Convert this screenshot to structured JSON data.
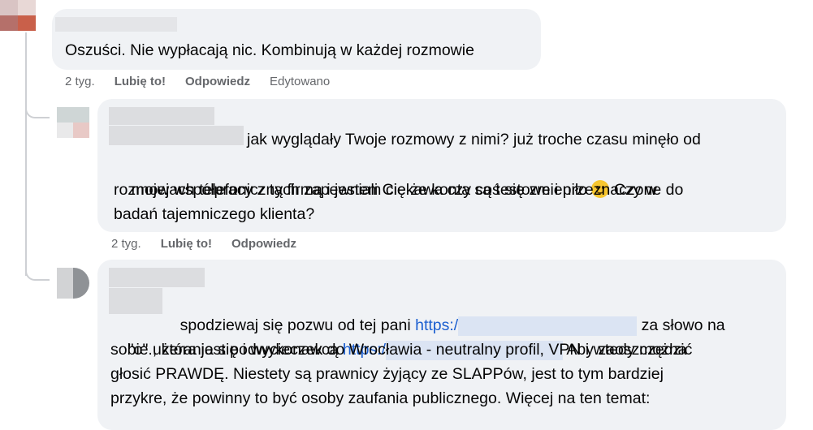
{
  "comments": [
    {
      "text": "Oszuści. Nie wypłacają nic. Kombinują w każdej rozmowie",
      "meta": {
        "time": "2 tyg.",
        "like": "Lubię to!",
        "reply": "Odpowiedz",
        "edited": "Edytowano"
      }
    },
    {
      "lines": [
        "jak wyglądały Twoje rozmowy z nimi? już troche czasu minęło od",
        "mojej współpracy z tą firmą i jestem ciekawa czy coś się zmieniło",
        "Czy w",
        "rozmowach telefonicznych zapewniali Cię że konta są testowe i przeznaczone do",
        "badań tajemniczego klienta?"
      ],
      "emoji": "smiling-face-emoji",
      "meta": {
        "time": "2 tyg.",
        "like": "Lubię to!",
        "reply": "Odpowiedz"
      }
    },
    {
      "parts": {
        "l1a": "spodziewaj się pozwu od tej pani",
        "l1link": "https:/",
        "l1b": "za słowo na",
        "l2a": "\"o\"., która jest podwykonawcą",
        "l2link": "https:/",
        "l2b": "Aby zaoszczędzić",
        "l3": "sobie użerania się i wycieczek do Wrocławia - neutralny profil, VPN i wtedy można",
        "l4": "głosić PRAWDĘ. Niestety są prawnicy żyjący ze SLAPPów, jest to tym bardziej",
        "l5": "przykre, że powinny to być osoby zaufania publicznego. Więcej na ten temat:"
      }
    }
  ],
  "colors": {
    "bubble": "#f0f2f5",
    "link": "#1b5fd0",
    "meta": "#65676b",
    "text": "#050505"
  }
}
